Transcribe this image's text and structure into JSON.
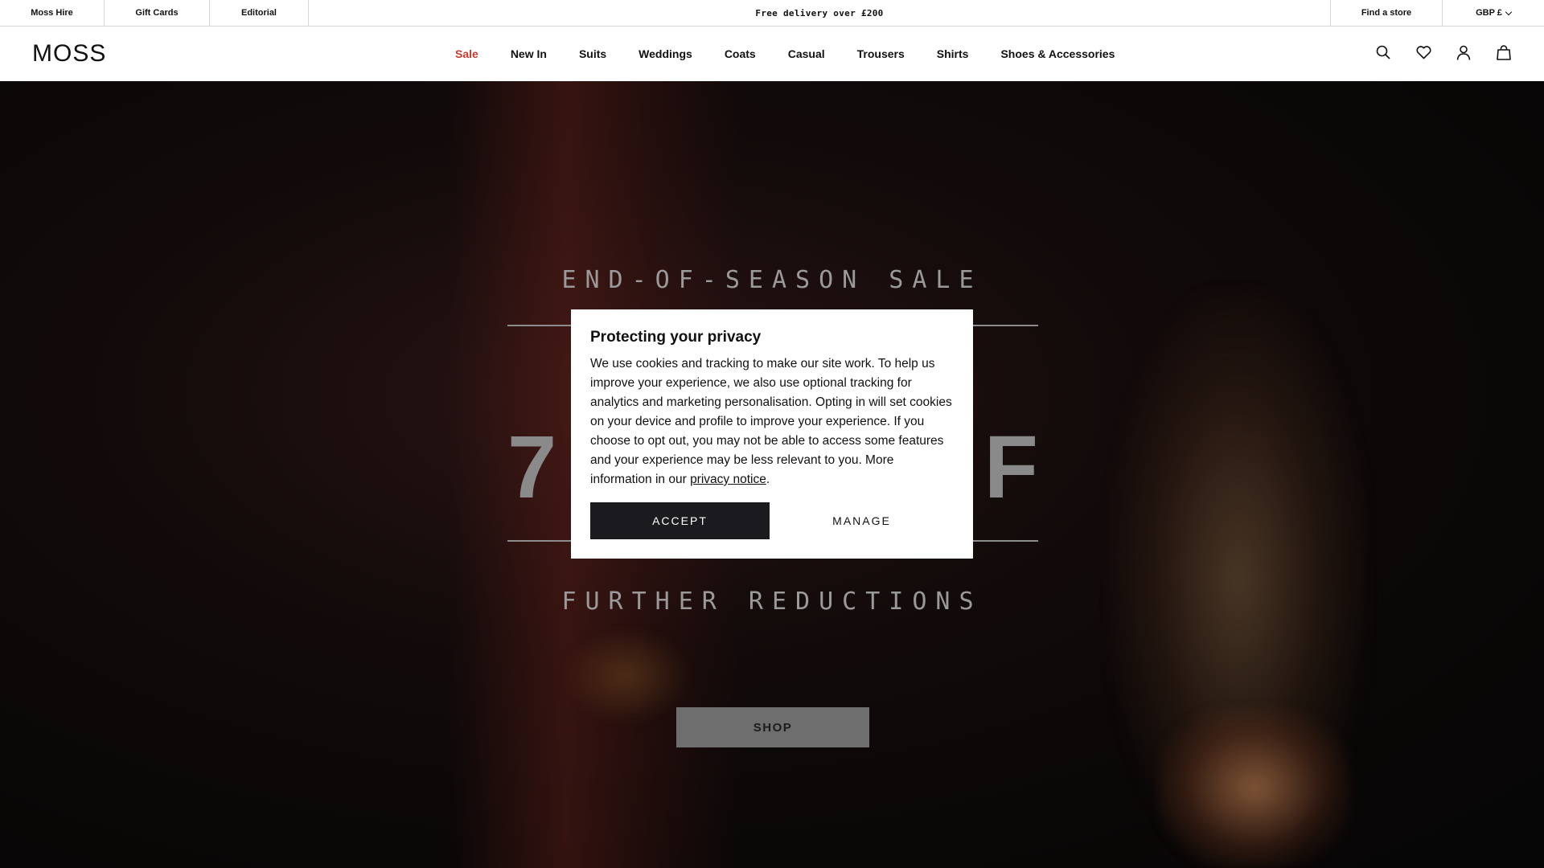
{
  "utility_bar": {
    "links_left": [
      "Moss Hire",
      "Gift Cards",
      "Editorial"
    ],
    "promo": "Free delivery over £200",
    "find_store": "Find a store",
    "currency": "GBP £"
  },
  "header": {
    "logo": "MOSS",
    "nav": [
      "Sale",
      "New In",
      "Suits",
      "Weddings",
      "Coats",
      "Casual",
      "Trousers",
      "Shirts",
      "Shoes & Accessories"
    ],
    "icons": [
      "search-icon",
      "heart-icon",
      "account-icon",
      "bag-icon"
    ]
  },
  "hero": {
    "eyebrow": "END-OF-SEASON SALE",
    "big_left": "7",
    "big_right": "F",
    "subline": "FURTHER REDUCTIONS",
    "shop_label": "SHOP"
  },
  "cookie_modal": {
    "title": "Protecting your privacy",
    "body": "We use cookies and tracking to make our site work. To help us improve your experience, we also use optional tracking for analytics and marketing personalisation. Opting in will set cookies on your device and profile to improve your experience. If you choose to opt out, you may not be able to access some features and your experience may be less relevant to you. More information in our ",
    "link": "privacy notice",
    "body_end": ".",
    "accept_label": "ACCEPT",
    "manage_label": "MANAGE"
  },
  "colors": {
    "sale_red": "#c8392f",
    "accept_dark": "#1b1b1f"
  }
}
